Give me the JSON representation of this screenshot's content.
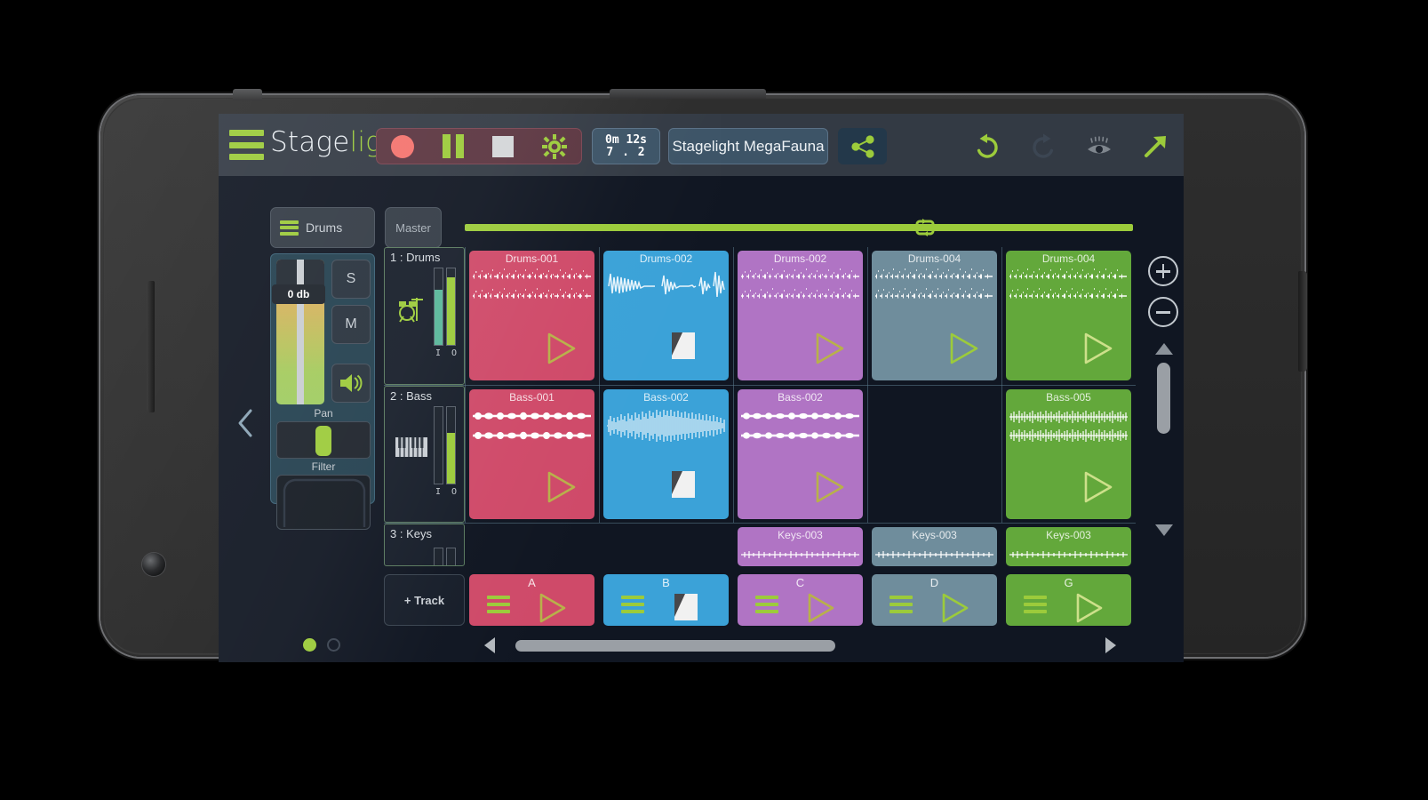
{
  "app": {
    "name_part1": "Stage",
    "name_part2": "light",
    "menu_icon": "hamburger-icon"
  },
  "transport": {
    "record_label": "Record",
    "pause_label": "Pause",
    "stop_label": "Stop",
    "settings_label": "Settings"
  },
  "time_display": {
    "elapsed": "0m 12s",
    "position": "7 . 2"
  },
  "project": {
    "name": "Stagelight MegaFauna"
  },
  "share": {
    "label": "Share"
  },
  "top_right": {
    "undo": "Undo",
    "redo": "Redo",
    "eye": "View",
    "arrow": "Expand"
  },
  "mixer": {
    "tab_label": "Drums",
    "master_label": "Master",
    "fader_value": "0 db",
    "solo_label": "S",
    "mute_label": "M",
    "pan_label": "Pan",
    "filter_label": "Filter",
    "speaker_label": "Speaker"
  },
  "tracks": [
    {
      "label": "1 : Drums",
      "icon": "drum-kit-icon",
      "io_label": "I O",
      "meter_in": 72,
      "meter_out": 88
    },
    {
      "label": "2 : Bass",
      "icon": "piano-keys-icon",
      "io_label": "I O",
      "meter_in": 0,
      "meter_out": 66
    },
    {
      "label": "3 : Keys",
      "icon": "meter-icon",
      "io_label": "",
      "meter_in": 0,
      "meter_out": 0
    }
  ],
  "colors": {
    "accent_green": "#9ccb3b",
    "clip_red": "#cf4a69",
    "clip_blue": "#3ba2d8",
    "clip_purple": "#b074c4",
    "clip_slate": "#6f8d9c",
    "clip_green": "#63a githubusercontent",
    "clip_green_hex": "#63a83b",
    "panel_bg": "#101622",
    "topbar_bg": "#333a44"
  },
  "scenes": [
    {
      "label": "A",
      "color": "#cf4a69",
      "action": "play"
    },
    {
      "label": "B",
      "color": "#3ba2d8",
      "action": "stop"
    },
    {
      "label": "C",
      "color": "#b074c4",
      "action": "play"
    },
    {
      "label": "D",
      "color": "#6f8d9c",
      "action": "play"
    },
    {
      "label": "G",
      "color": "#63a83b",
      "action": "play"
    }
  ],
  "clips": [
    [
      {
        "title": "Drums-001",
        "color": "#cf4a69",
        "wave": "dense2",
        "action": "play",
        "tri": "#b8b14a"
      },
      {
        "title": "Drums-002",
        "color": "#3ba2d8",
        "wave": "sparse",
        "action": "stop",
        "tri": ""
      },
      {
        "title": "Drums-002",
        "color": "#b074c4",
        "wave": "dense2",
        "action": "play",
        "tri": "#b8b14a"
      },
      {
        "title": "Drums-004",
        "color": "#6f8d9c",
        "wave": "dense2",
        "action": "play",
        "tri": "#9ccb3b"
      },
      {
        "title": "Drums-004",
        "color": "#63a83b",
        "wave": "dense2",
        "action": "play",
        "tri": "#cde08a"
      }
    ],
    [
      {
        "title": "Bass-001",
        "color": "#cf4a69",
        "wave": "bass",
        "action": "play",
        "tri": "#b8b14a"
      },
      {
        "title": "Bass-002",
        "color": "#3ba2d8",
        "wave": "swell",
        "action": "stop",
        "tri": ""
      },
      {
        "title": "Bass-002",
        "color": "#b074c4",
        "wave": "bass",
        "action": "play",
        "tri": "#b8b14a"
      },
      null,
      {
        "title": "Bass-005",
        "color": "#63a83b",
        "wave": "bass2",
        "action": "play",
        "tri": "#cde08a"
      }
    ],
    [
      null,
      null,
      {
        "title": "Keys-003",
        "color": "#b074c4",
        "wave": "thin",
        "action": "",
        "tri": ""
      },
      {
        "title": "Keys-003",
        "color": "#6f8d9c",
        "wave": "thin",
        "action": "",
        "tri": ""
      },
      {
        "title": "Keys-003",
        "color": "#63a83b",
        "wave": "thin",
        "action": "",
        "tri": ""
      }
    ]
  ],
  "add_track": {
    "label": "+ Track"
  },
  "rail": {
    "zoom_in": "+",
    "zoom_out": "−",
    "scroll_up": "up",
    "scroll_down": "down"
  },
  "page_dots": {
    "active_index": 0,
    "count": 2
  },
  "hscroll": {
    "left": "◀",
    "right": "▶"
  }
}
